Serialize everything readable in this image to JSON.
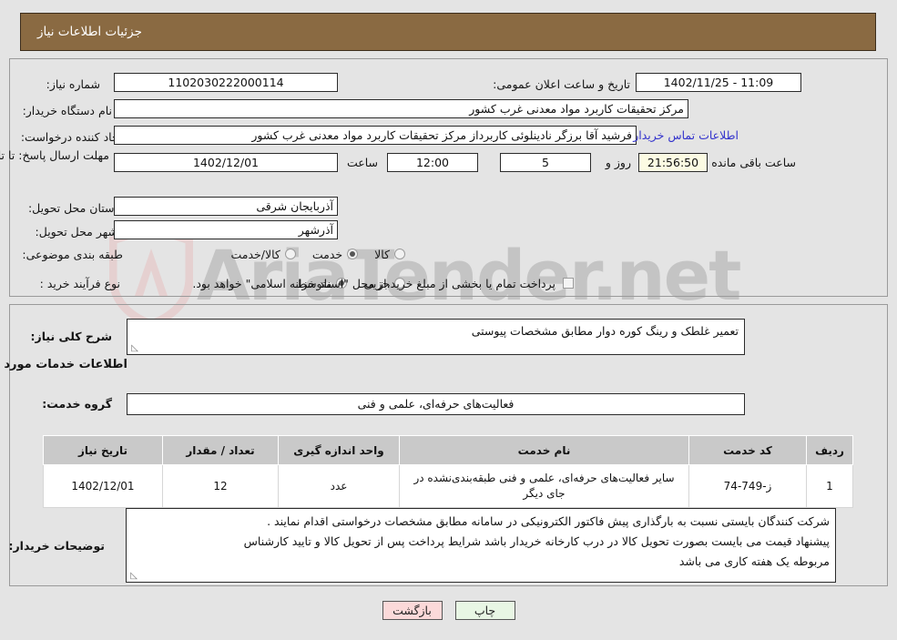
{
  "header": {
    "title": "جزئیات اطلاعات نیاز"
  },
  "watermark": {
    "text": "AriaTender.net"
  },
  "fields": {
    "need_number_label": "شماره نیاز:",
    "need_number_value": "1102030222000114",
    "announce_datetime_label": "تاریخ و ساعت اعلان عمومی:",
    "announce_datetime_value": "11:09 - 1402/11/25",
    "buyer_org_label": "نام دستگاه خریدار:",
    "buyer_org_value": "مرکز تحقیقات کاربرد مواد معدنی غرب کشور",
    "creator_label": "ایجاد کننده درخواست:",
    "creator_value": "فرشید آقا برزگر نادینلوئی کاربرداز مرکز تحقیقات کاربرد مواد معدنی غرب کشور",
    "contact_link": "اطلاعات تماس خریدار",
    "deadline_label": "مهلت ارسال پاسخ: تا تاریخ:",
    "deadline_date": "1402/12/01",
    "deadline_hour_label": "ساعت",
    "deadline_hour_value": "12:00",
    "remaining_days": "5",
    "remaining_days_label": "روز و",
    "remaining_time": "21:56:50",
    "remaining_suffix": "ساعت باقی مانده",
    "province_label": "استان محل تحویل:",
    "province_value": "آذربایجان شرقی",
    "city_label": "شهر محل تحویل:",
    "city_value": "آذرشهر",
    "category_label": "طبقه بندی موضوعی:",
    "category_options": [
      {
        "label": "کالا",
        "selected": false
      },
      {
        "label": "خدمت",
        "selected": true
      },
      {
        "label": "کالا/خدمت",
        "selected": false
      }
    ],
    "process_label": "نوع فرآیند خرید :",
    "process_options": [
      {
        "label": "جزیی",
        "selected": false
      },
      {
        "label": "متوسط",
        "selected": true
      }
    ],
    "treasury_checkbox_checked": false,
    "treasury_text": "پرداخت تمام یا بخشی از مبلغ خرید،از محل \"اسناد خزانه اسلامی\" خواهد بود."
  },
  "description": {
    "label": "شرح کلی نیاز:",
    "value": "تعمیر غلطک و رینگ کوره دوار مطابق مشخصات پیوستی"
  },
  "services_section": {
    "heading": "اطلاعات خدمات مورد نیاز",
    "group_label": "گروه خدمت:",
    "group_value": "فعالیت‌های حرفه‌ای، علمی و فنی"
  },
  "table": {
    "headers": [
      "ردیف",
      "کد خدمت",
      "نام خدمت",
      "واحد اندازه گیری",
      "تعداد / مقدار",
      "تاریخ نیاز"
    ],
    "rows": [
      {
        "row": "1",
        "code": "ز-749-74",
        "name": "سایر فعالیت‌های حرفه‌ای، علمی و فنی طبقه‌بندی‌نشده در جای دیگر",
        "unit": "عدد",
        "quantity": "12",
        "date": "1402/12/01"
      }
    ]
  },
  "buyer_notes": {
    "label": "توضیحات خریدار:",
    "line1": "شرکت کنندگان بایستی نسبت به بارگذاری پیش فاکتور الکترونیکی در سامانه  مطابق مشخصات درخواستی اقدام نمایند .",
    "line2": "پیشنهاد قیمت می بایست بصورت تحویل کالا در درب کارخانه خریدار باشد  شرایط پرداخت پس از تحویل کالا و تایید کارشناس",
    "line3": "مربوطه یک هفته کاری می باشد"
  },
  "buttons": {
    "print": "چاپ",
    "back": "بازگشت"
  }
}
